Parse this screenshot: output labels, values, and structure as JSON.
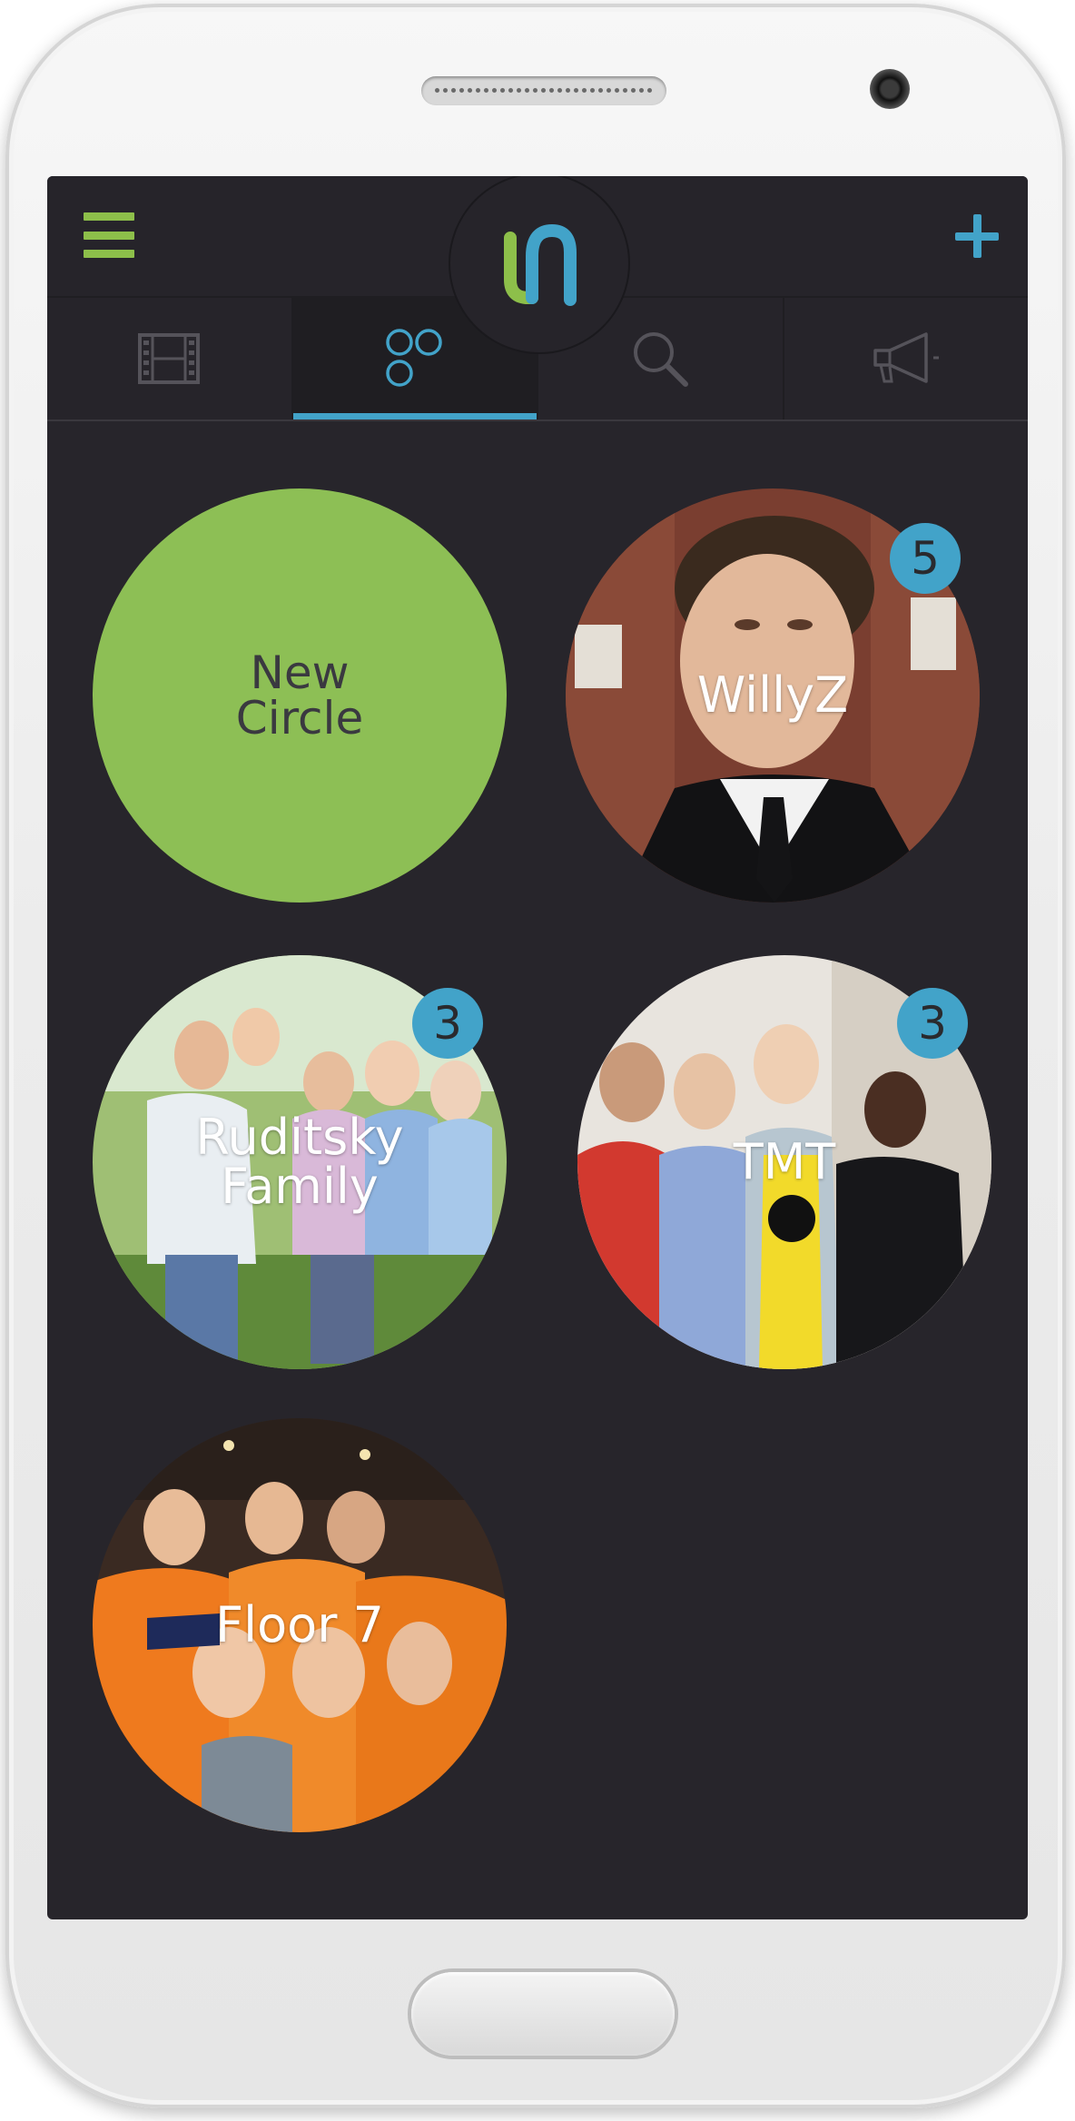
{
  "header": {
    "menu_icon": "hamburger-menu-icon",
    "logo_icon": "app-logo-icon",
    "add_icon": "plus-icon"
  },
  "tabs": [
    {
      "icon": "film-strip-icon",
      "active": false
    },
    {
      "icon": "circles-icon",
      "active": true
    },
    {
      "icon": "search-icon",
      "active": false
    },
    {
      "icon": "megaphone-icon",
      "active": false
    }
  ],
  "circles": [
    {
      "label": "New\nCircle",
      "badge": null
    },
    {
      "label": "WillyZ",
      "badge": "5"
    },
    {
      "label": "Ruditsky\nFamily",
      "badge": "3"
    },
    {
      "label": "TMT",
      "badge": "3"
    },
    {
      "label": "Floor 7",
      "badge": null
    }
  ],
  "colors": {
    "accent_blue": "#42a3c9",
    "accent_green": "#8dbf55",
    "background": "#27252b"
  }
}
